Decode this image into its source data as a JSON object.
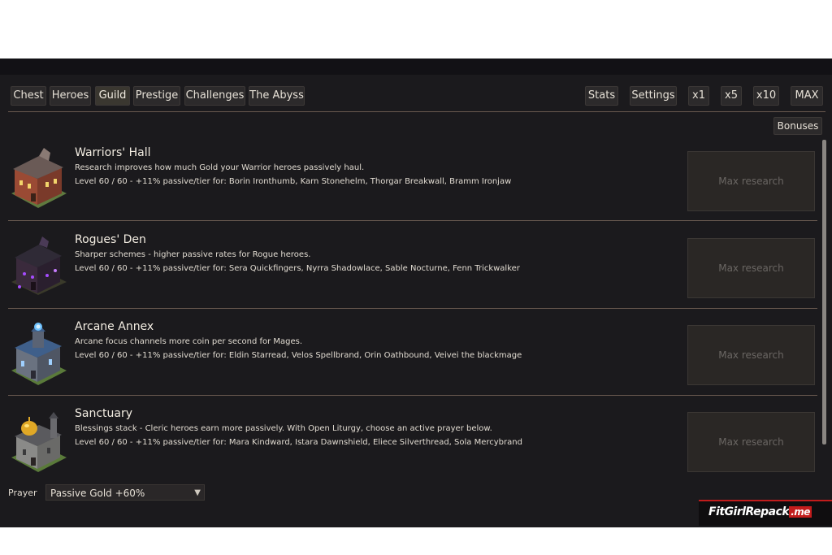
{
  "tabs": [
    "Chest",
    "Heroes",
    "Guild",
    "Prestige",
    "Challenges",
    "The Abyss"
  ],
  "right_buttons": [
    "Stats",
    "Settings",
    "x1",
    "x5",
    "x10",
    "MAX"
  ],
  "bonuses_label": "Bonuses",
  "guilds": [
    {
      "title": "Warriors' Hall",
      "description": "Research improves how much Gold your Warrior heroes passively haul.",
      "level": "Level 60 / 60 - +11% passive/tier for: Borin Ironthumb, Karn Stonehelm, Thorgar Breakwall, Bramm Ironjaw",
      "button": "Max research"
    },
    {
      "title": "Rogues' Den",
      "description": "Sharper schemes - higher passive rates for Rogue heroes.",
      "level": "Level 60 / 60 - +11% passive/tier for: Sera Quickfingers, Nyrra Shadowlace, Sable Nocturne, Fenn Trickwalker",
      "button": "Max research"
    },
    {
      "title": "Arcane Annex",
      "description": "Arcane focus channels more coin per second for Mages.",
      "level": "Level 60 / 60 - +11% passive/tier for: Eldin Starread, Velos Spellbrand, Orin Oathbound, Veivei the blackmage",
      "button": "Max research"
    },
    {
      "title": "Sanctuary",
      "description": "Blessings stack - Cleric heroes earn more passively. With Open Liturgy, choose an active prayer below.",
      "level": "Level 60 / 60 - +11% passive/tier for: Mara Kindward, Istara Dawnshield, Eliece Silverthread, Sola Mercybrand",
      "button": "Max research"
    }
  ],
  "prayer": {
    "label": "Prayer",
    "selected": "Passive Gold +60%"
  },
  "watermark": {
    "text": "FitGirlRepack",
    "suffix": ".me"
  },
  "colors": {
    "background": "#1b1a1d",
    "panel_button": "#2a2725",
    "separator": "#6a5a50",
    "watermark_red": "#c21c1c"
  }
}
